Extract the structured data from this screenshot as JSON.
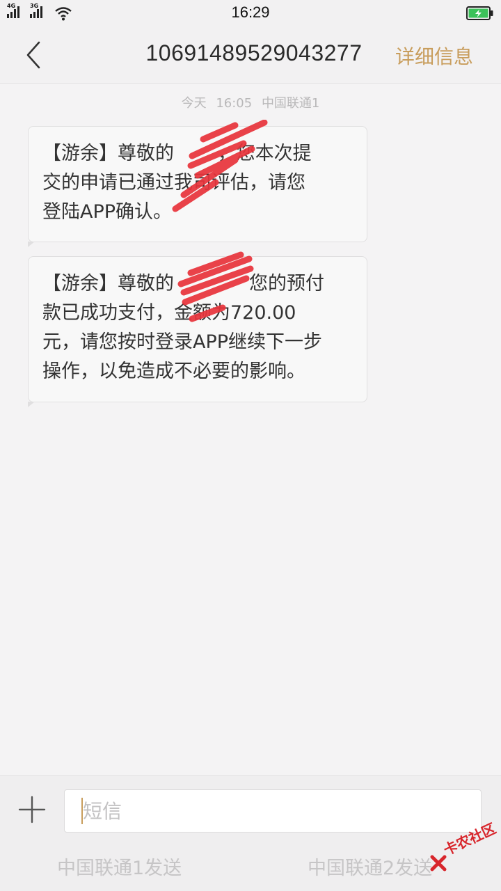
{
  "status_bar": {
    "network_1": "4G",
    "network_2": "3G",
    "time": "16:29",
    "icons": [
      "signal-icon",
      "signal-icon",
      "wifi-icon",
      "battery-charging-icon"
    ]
  },
  "header": {
    "sender_number": "10691489529043277",
    "details_label": "详细信息"
  },
  "conversation": {
    "timestamp": {
      "day": "今天",
      "time": "16:05",
      "carrier": "中国联通1"
    },
    "messages": [
      {
        "lines": [
          "【游余】尊敬的",
          "，您本次提",
          "交的申请已通",
          "我司评估，请您",
          "登陆APP确认。"
        ],
        "line1": "【游余】尊敬的  　　，您本次提",
        "line2": "交的申请已通过我司评估，请您",
        "line3": "登陆APP确认。"
      },
      {
        "line1": "【游余】尊敬的　　　　您的预付",
        "line2": "款已成功支付，金额为720.00",
        "line3": "元，请您按时登录APP继续下一步",
        "line4": "操作，以免造成不必要的影响。"
      }
    ]
  },
  "input_bar": {
    "placeholder": "短信",
    "send_sim1": "中国联通1发送",
    "send_sim2": "中国联通2发送"
  },
  "watermark": {
    "text": "卡农社区"
  },
  "colors": {
    "accent": "#c89d5c",
    "scribble": "#e8333b",
    "background": "#f4f3f4"
  }
}
